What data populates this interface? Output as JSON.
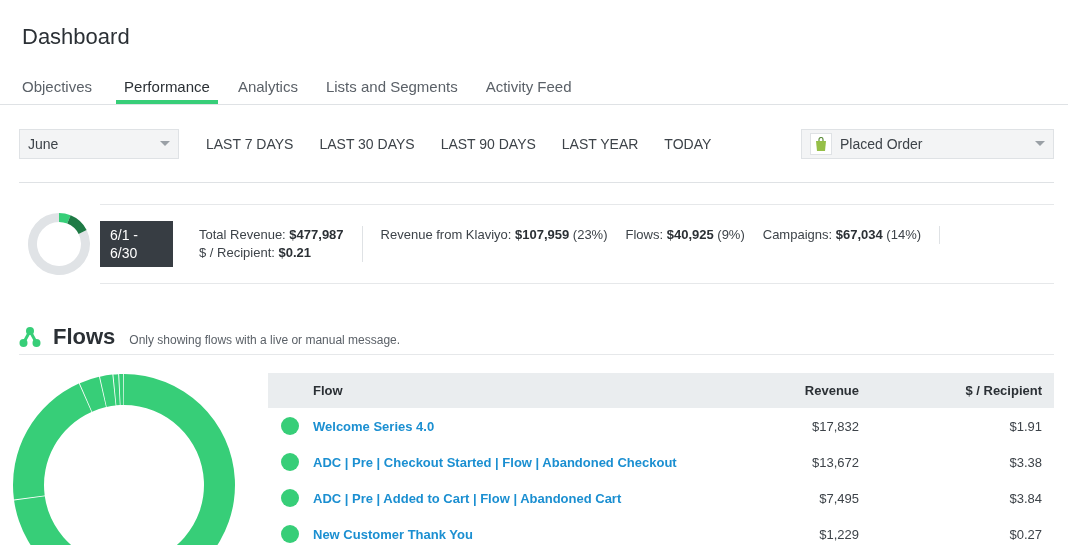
{
  "page": {
    "title": "Dashboard"
  },
  "tabs": [
    {
      "label": "Objectives",
      "selected": false
    },
    {
      "label": "Performance",
      "selected": true
    },
    {
      "label": "Analytics",
      "selected": false
    },
    {
      "label": "Lists and Segments",
      "selected": false
    },
    {
      "label": "Activity Feed",
      "selected": false
    }
  ],
  "filters": {
    "month": {
      "value": "June"
    },
    "ranges": [
      "LAST 7 DAYS",
      "LAST 30 DAYS",
      "LAST 90 DAYS",
      "LAST YEAR",
      "TODAY"
    ],
    "metric": {
      "value": "Placed Order"
    }
  },
  "summary": {
    "date_badge": "6/1 - 6/30",
    "stats": [
      [
        "Total Revenue: **$477,987**",
        "$ / Recipient: **$0.21**"
      ],
      [
        "Revenue from Klaviyo: **$107,959** (23%)"
      ],
      [
        "Flows: **$40,925** (9%)"
      ],
      [
        "Campaigns: **$67,034** (14%)"
      ]
    ]
  },
  "flows": {
    "title": "Flows",
    "subtitle": "Only showing flows with a live or manual message.",
    "table": {
      "columns": [
        "Flow",
        "Revenue",
        "$ / Recipient"
      ],
      "rows": [
        {
          "flow": "Welcome Series 4.0",
          "revenue": "$17,832",
          "per_recipient": "$1.91",
          "color": "#37ce78"
        },
        {
          "flow": "ADC | Pre | Checkout Started | Flow | Abandoned Checkout",
          "revenue": "$13,672",
          "per_recipient": "$3.38",
          "color": "#37ce78"
        },
        {
          "flow": "ADC | Pre | Added to Cart | Flow | Abandoned Cart",
          "revenue": "$7,495",
          "per_recipient": "$3.84",
          "color": "#37ce78"
        },
        {
          "flow": "New Customer Thank You",
          "revenue": "$1,229",
          "per_recipient": "$0.27",
          "color": "#37ce78"
        }
      ]
    }
  }
}
